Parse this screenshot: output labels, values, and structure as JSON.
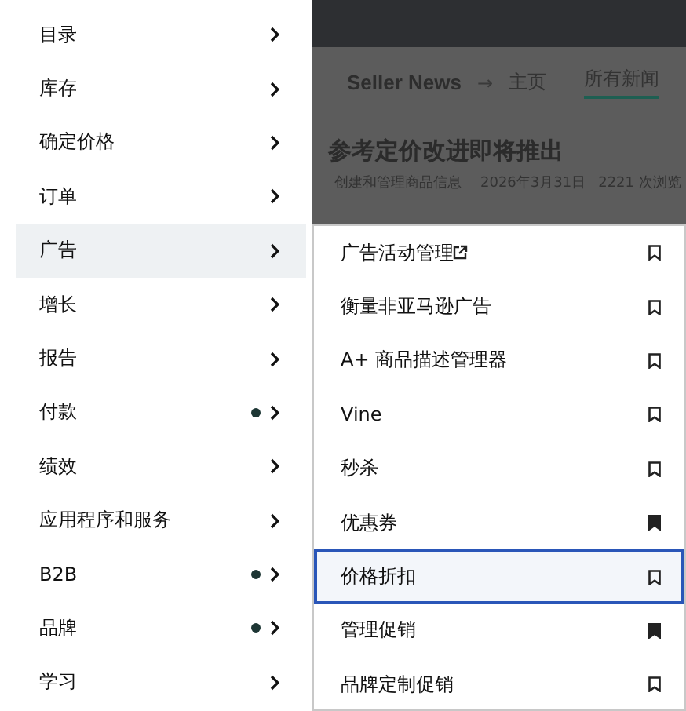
{
  "background_page": {
    "breadcrumb": {
      "site": "Seller News",
      "arrow": "→",
      "home": "主页",
      "tabs": [
        {
          "label": "所有新闻",
          "selected": true
        }
      ]
    },
    "article": {
      "title": "参考定价改进即将推出",
      "category": "创建和管理商品信息",
      "date": "2026年3月31日",
      "views": "2221 次浏览"
    }
  },
  "menu": {
    "items": [
      {
        "label": "目录",
        "selected": false,
        "dot": false
      },
      {
        "label": "库存",
        "selected": false,
        "dot": false
      },
      {
        "label": "确定价格",
        "selected": false,
        "dot": false
      },
      {
        "label": "订单",
        "selected": false,
        "dot": false
      },
      {
        "label": "广告",
        "selected": true,
        "dot": false
      },
      {
        "label": "增长",
        "selected": false,
        "dot": false
      },
      {
        "label": "报告",
        "selected": false,
        "dot": false
      },
      {
        "label": "付款",
        "selected": false,
        "dot": true
      },
      {
        "label": "绩效",
        "selected": false,
        "dot": false
      },
      {
        "label": "应用程序和服务",
        "selected": false,
        "dot": false
      },
      {
        "label": "B2B",
        "selected": false,
        "dot": true
      },
      {
        "label": "品牌",
        "selected": false,
        "dot": true
      },
      {
        "label": "学习",
        "selected": false,
        "dot": false
      }
    ]
  },
  "submenu": {
    "items": [
      {
        "label": "广告活动管理",
        "external": true,
        "bookmarked": false,
        "selected": false
      },
      {
        "label": "衡量非亚马逊广告",
        "external": false,
        "bookmarked": false,
        "selected": false
      },
      {
        "label": "A+ 商品描述管理器",
        "external": false,
        "bookmarked": false,
        "selected": false
      },
      {
        "label": "Vine",
        "external": false,
        "bookmarked": false,
        "selected": false
      },
      {
        "label": "秒杀",
        "external": false,
        "bookmarked": false,
        "selected": false
      },
      {
        "label": "优惠券",
        "external": false,
        "bookmarked": true,
        "selected": false
      },
      {
        "label": "价格折扣",
        "external": false,
        "bookmarked": false,
        "selected": true
      },
      {
        "label": "管理促销",
        "external": false,
        "bookmarked": true,
        "selected": false
      },
      {
        "label": "品牌定制促销",
        "external": false,
        "bookmarked": false,
        "selected": false
      }
    ]
  }
}
